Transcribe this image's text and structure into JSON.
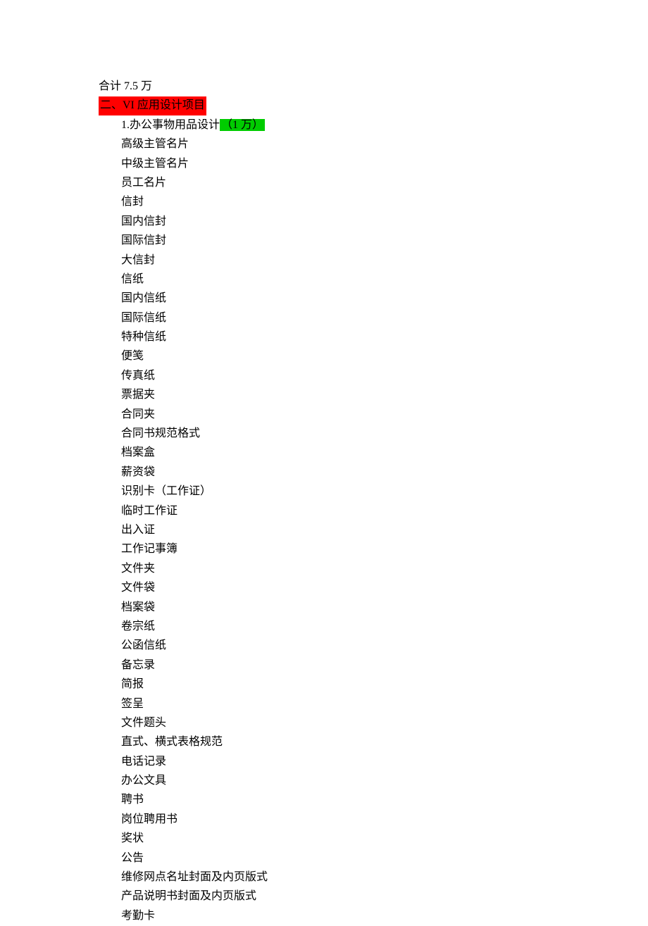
{
  "header": {
    "total": "合计 7.5 万"
  },
  "section": {
    "title": "二、VI 应用设计项目"
  },
  "subsection": {
    "title": "1.办公事物用品设计",
    "price": "（1 万）"
  },
  "items": [
    "高级主管名片",
    "中级主管名片",
    "员工名片",
    "信封",
    "国内信封",
    "国际信封",
    "大信封",
    "信纸",
    "国内信纸",
    "国际信纸",
    "特种信纸",
    "便笺",
    "传真纸",
    "票据夹",
    "合同夹",
    "合同书规范格式",
    "档案盒",
    "薪资袋",
    "识别卡（工作证）",
    "临时工作证",
    "出入证",
    "工作记事簿",
    "文件夹",
    "文件袋",
    "档案袋",
    "卷宗纸",
    "公函信纸",
    "备忘录",
    "简报",
    "签呈",
    "文件题头",
    "直式、横式表格规范",
    "电话记录",
    "办公文具",
    "聘书",
    "岗位聘用书",
    "奖状",
    "公告",
    "维修网点名址封面及内页版式",
    "产品说明书封面及内页版式",
    "考勤卡"
  ]
}
